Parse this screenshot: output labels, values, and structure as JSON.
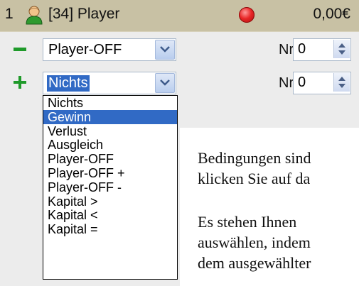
{
  "header": {
    "index": "1",
    "player_name": "[34] Player",
    "amount": "0,00€"
  },
  "rows": [
    {
      "action_icon": "minus-icon",
      "combo_value": "Player-OFF",
      "nr_label": "Nr.",
      "nr_value": "0"
    },
    {
      "action_icon": "plus-icon",
      "combo_value": "Nichts",
      "nr_label": "Nr.",
      "nr_value": "0"
    }
  ],
  "dropdown": {
    "options": [
      "Nichts",
      "Gewinn",
      "Verlust",
      "Ausgleich",
      "Player-OFF",
      "Player-OFF +",
      "Player-OFF -",
      "Kapital >",
      "Kapital <",
      "Kapital ="
    ],
    "highlighted": "Gewinn"
  },
  "doc_text": {
    "line1": "Bedingungen sind",
    "line2": "klicken Sie auf da",
    "line3": "Es stehen Ihnen",
    "line4": "auswählen, indem",
    "line5": "dem ausgewählter"
  },
  "colors": {
    "header_bg": "#c8c1a4",
    "selection": "#316ac5",
    "status_red": "#e82626",
    "minus_green": "#1f9a2a",
    "plus_green": "#1f9a2a"
  }
}
